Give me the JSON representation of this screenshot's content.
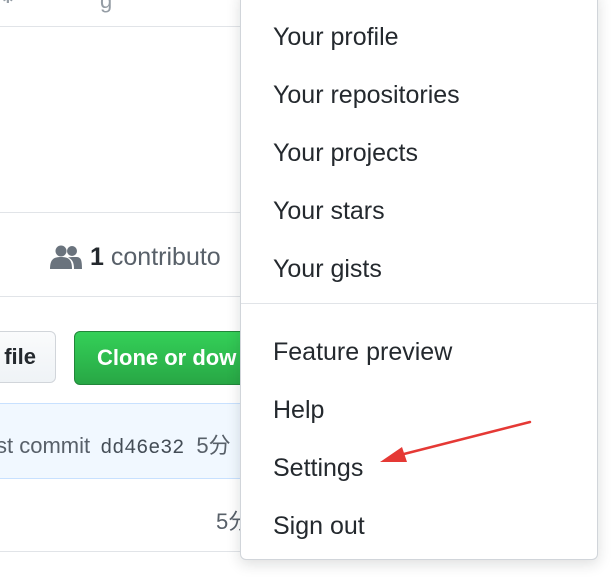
{
  "repo_page": {
    "top_partial_text": "g",
    "contributors": {
      "count": "1",
      "label": "contributo"
    },
    "file_button_label": "file",
    "clone_button_label": "Clone or dow",
    "commit": {
      "prefix": "st commit",
      "sha": "dd46e32",
      "time": "5分"
    },
    "row_time": "5分"
  },
  "user_menu": {
    "items": [
      {
        "label": "Your profile"
      },
      {
        "label": "Your repositories"
      },
      {
        "label": "Your projects"
      },
      {
        "label": "Your stars"
      },
      {
        "label": "Your gists"
      }
    ],
    "items_secondary": [
      {
        "label": "Feature preview"
      },
      {
        "label": "Help"
      },
      {
        "label": "Settings"
      },
      {
        "label": "Sign out"
      }
    ]
  },
  "colors": {
    "clone_button": "#28a745",
    "annotation_arrow": "#e53935"
  },
  "icons": {
    "contributors": "people-icon",
    "top_partial": "gear-icon"
  }
}
